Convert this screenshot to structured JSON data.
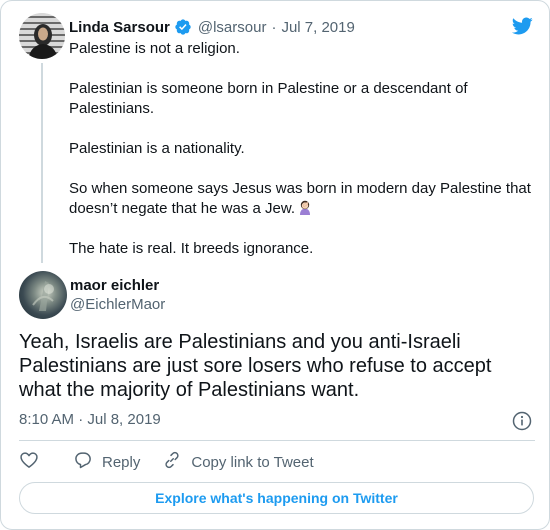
{
  "parent_tweet": {
    "author_name": "Linda Sarsour",
    "handle": "@lsarsour",
    "separator": "·",
    "date": "Jul 7, 2019",
    "paragraphs": [
      "Palestine is not a religion.",
      "Palestinian is someone born in Palestine or a descendant of Palestinians.",
      "Palestinian is a nationality.",
      "So when someone says Jesus was born in modern day Palestine that doesn’t negate that he was a Jew.",
      "The hate is real. It breeds ignorance."
    ],
    "emoji": "woman-facepalming-emoji"
  },
  "reply_tweet": {
    "author_name": "maor eichler",
    "handle": "@EichlerMaor",
    "text": "Yeah, Israelis are Palestinians and you anti-Israeli Palestinians are just sore losers who refuse to accept what the majority of Palestinians want.",
    "timestamp": "8:10 AM · Jul 8, 2019"
  },
  "actions": {
    "like_icon": "heart-icon",
    "reply_label": "Reply",
    "copy_label": "Copy link to Tweet"
  },
  "footer": {
    "explore_label": "Explore what's happening on Twitter"
  },
  "colors": {
    "accent": "#1d9bf0",
    "text": "#0f1419",
    "secondary": "#536471",
    "border": "#cfd9de"
  }
}
